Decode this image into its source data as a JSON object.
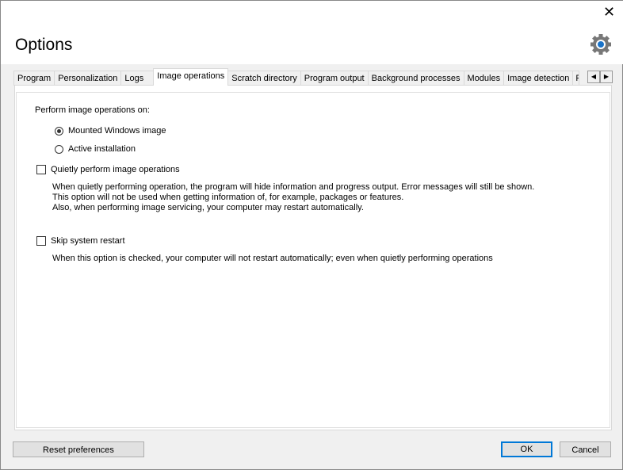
{
  "window": {
    "title": "Options",
    "close_icon": "close-icon",
    "settings_icon": "gear-icon"
  },
  "tabs": [
    {
      "label": "Program"
    },
    {
      "label": "Personalization"
    },
    {
      "label": "Logs"
    },
    {
      "label": "Image operations",
      "active": true
    },
    {
      "label": "Scratch directory"
    },
    {
      "label": "Program output"
    },
    {
      "label": "Background processes"
    },
    {
      "label": "Modules"
    },
    {
      "label": "Image detection"
    },
    {
      "label": "F"
    }
  ],
  "content": {
    "perform_label": "Perform image operations on:",
    "radios": [
      {
        "label": "Mounted Windows image",
        "checked": true
      },
      {
        "label": "Active installation",
        "checked": false
      }
    ],
    "quiet": {
      "label": "Quietly perform image operations",
      "checked": false,
      "desc": [
        "When quietly performing operation, the program will hide information and progress output. Error messages will still be shown.",
        "This option will not be used when getting information of, for example, packages or features.",
        "Also, when performing image servicing, your computer may restart automatically."
      ]
    },
    "skip": {
      "label": "Skip system restart",
      "checked": false,
      "desc": "When this option is checked, your computer will not restart automatically; even when quietly performing operations"
    }
  },
  "buttons": {
    "reset": "Reset preferences",
    "ok": "OK",
    "cancel": "Cancel"
  },
  "colors": {
    "accent": "#0078d7"
  }
}
